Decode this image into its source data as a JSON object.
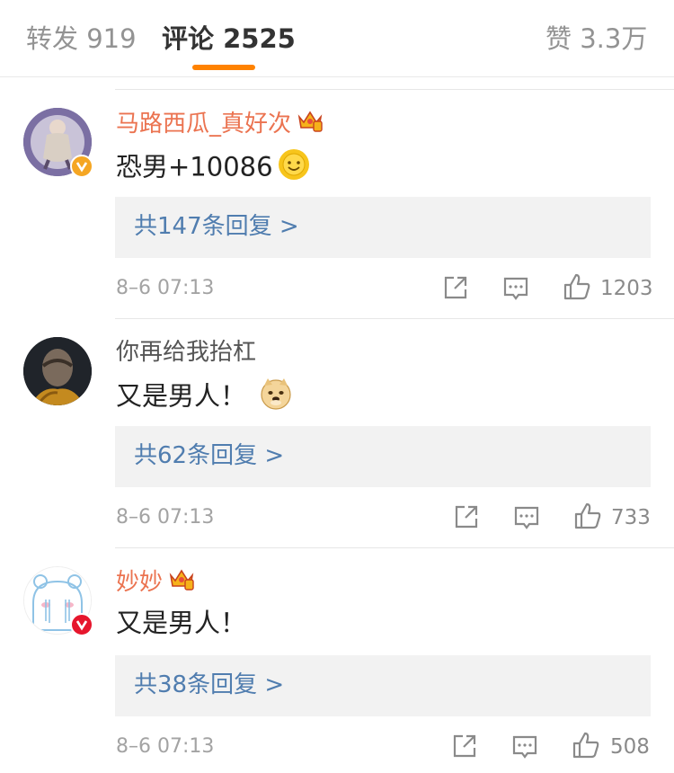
{
  "tabs": [
    {
      "label": "转发 919"
    },
    {
      "label": "评论 2525"
    },
    {
      "label": "赞 3.3万"
    }
  ],
  "comments": [
    {
      "username": "马路西瓜_真好次",
      "text": "恐男+10086",
      "replies": "共147条回复 >",
      "time": "8–6 07:13",
      "likes": "1203",
      "badge_color": "#f5a623"
    },
    {
      "username": "你再给我抬杠",
      "text": "又是男人！",
      "replies": "共62条回复 >",
      "time": "8–6 07:13",
      "likes": "733"
    },
    {
      "username": "妙妙",
      "text": "又是男人！",
      "replies": "共38条回复 >",
      "time": "8–6 07:13",
      "likes": "508",
      "badge_color": "#e6162d"
    }
  ],
  "colors": {
    "accent": "#ff8200",
    "vip_name": "#eb7350",
    "link": "#507daf"
  }
}
